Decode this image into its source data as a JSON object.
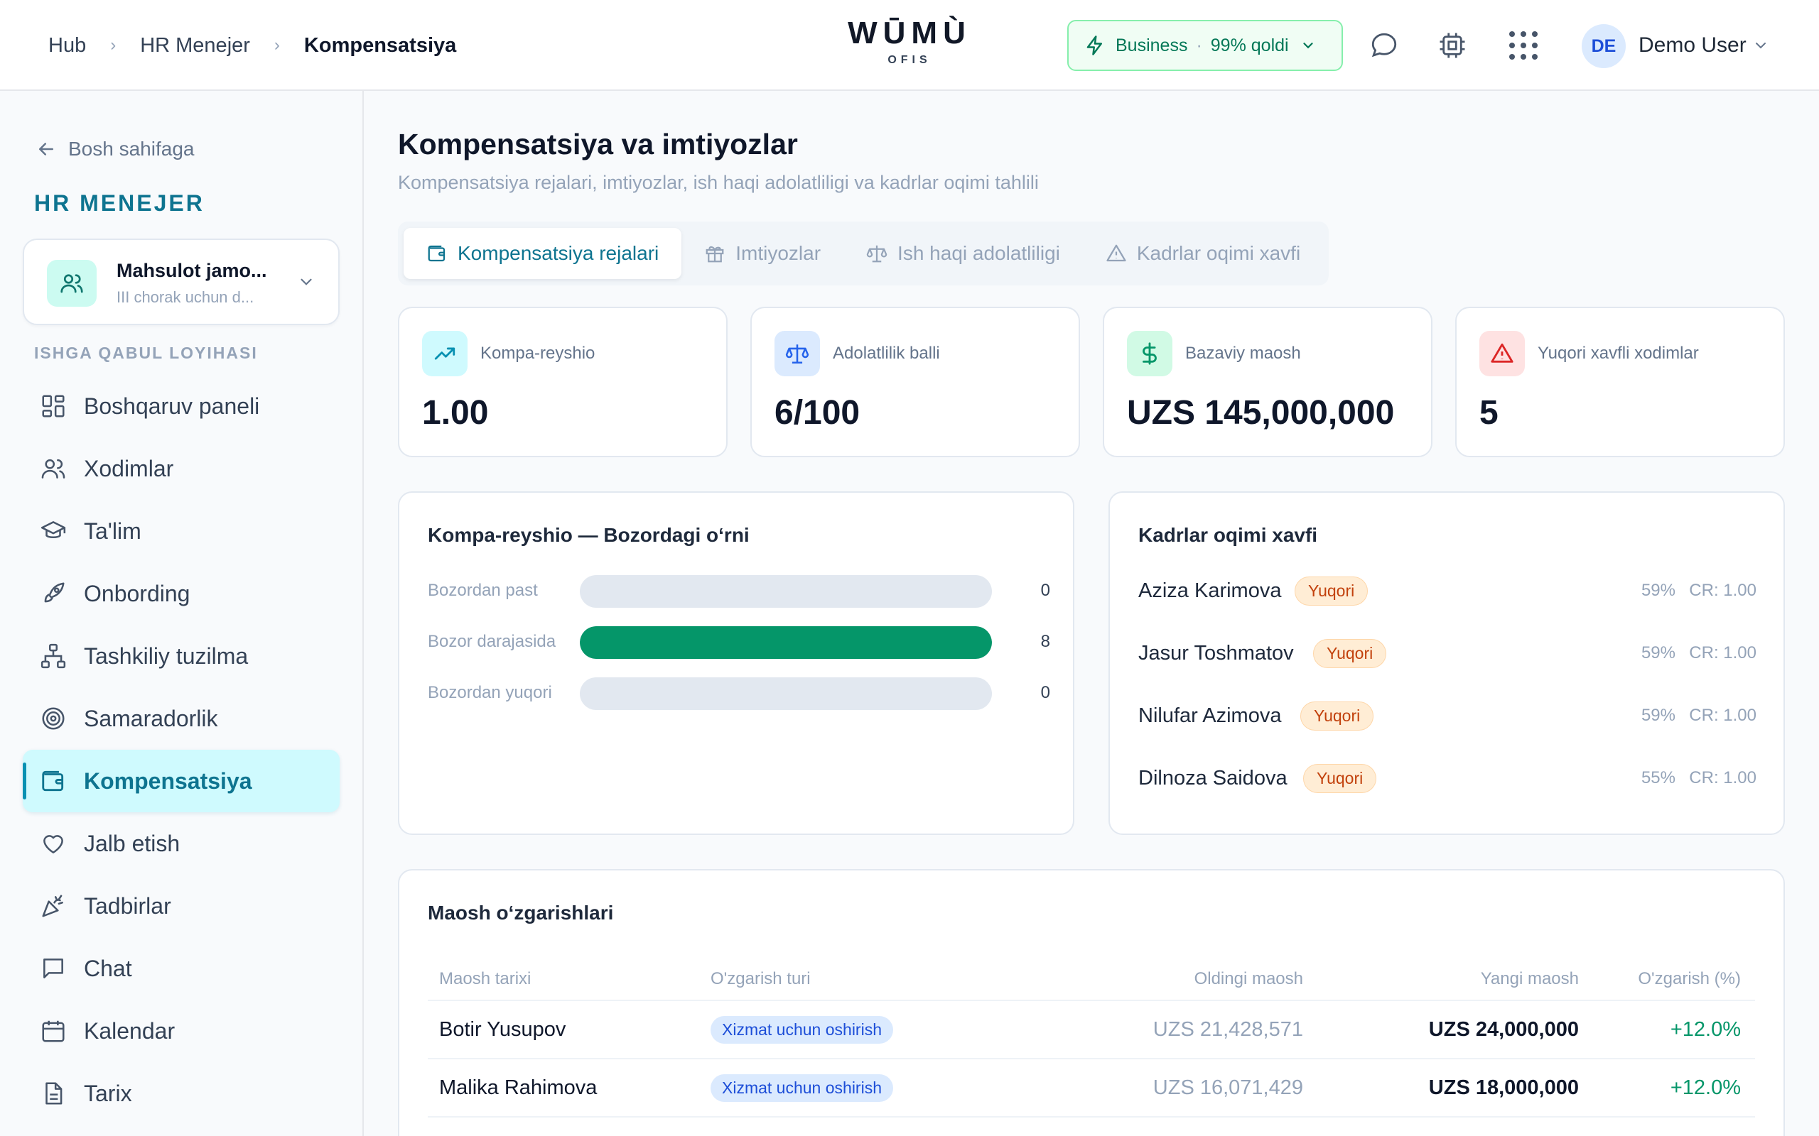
{
  "header": {
    "breadcrumbs": [
      "Hub",
      "HR Menejer",
      "Kompensatsiya"
    ],
    "logo_mark": "WŪMÙ",
    "logo_sub": "OFIS",
    "plan_name": "Business",
    "plan_dot": "·",
    "plan_quota": "99% qoldi",
    "user_initials": "DE",
    "user_name": "Demo User"
  },
  "sidebar": {
    "back_label": "Bosh sahifaga",
    "role_title": "HR MENEJER",
    "team_name": "Mahsulot jamo...",
    "team_sub": "III chorak uchun d...",
    "section_label": "ISHGA QABUL LOYIHASI",
    "items": [
      {
        "label": "Boshqaruv paneli",
        "icon": "dashboard-icon"
      },
      {
        "label": "Xodimlar",
        "icon": "users-icon"
      },
      {
        "label": "Ta'lim",
        "icon": "graduation-cap-icon"
      },
      {
        "label": "Onbording",
        "icon": "rocket-icon"
      },
      {
        "label": "Tashkiliy tuzilma",
        "icon": "org-chart-icon"
      },
      {
        "label": "Samaradorlik",
        "icon": "target-icon"
      },
      {
        "label": "Kompensatsiya",
        "icon": "wallet-icon",
        "active": true
      },
      {
        "label": "Jalb etish",
        "icon": "heart-icon"
      },
      {
        "label": "Tadbirlar",
        "icon": "party-icon"
      },
      {
        "label": "Chat",
        "icon": "chat-icon"
      },
      {
        "label": "Kalendar",
        "icon": "calendar-icon"
      },
      {
        "label": "Tarix",
        "icon": "document-icon"
      }
    ]
  },
  "page": {
    "title": "Kompensatsiya va imtiyozlar",
    "subtitle": "Kompensatsiya rejalari, imtiyozlar, ish haqi adolatliligi va kadrlar oqimi tahlili",
    "tabs": [
      {
        "label": "Kompensatsiya rejalari",
        "icon": "wallet-icon",
        "active": true
      },
      {
        "label": "Imtiyozlar",
        "icon": "gift-icon"
      },
      {
        "label": "Ish haqi adolatliligi",
        "icon": "scale-icon"
      },
      {
        "label": "Kadrlar oqimi xavfi",
        "icon": "warning-icon"
      }
    ]
  },
  "stats": [
    {
      "label": "Kompa-reyshio",
      "value": "1.00",
      "icon": "trending-up-icon",
      "color": "#0891b2"
    },
    {
      "label": "Adolatlilik balli",
      "value": "6/100",
      "icon": "scale-icon",
      "color": "#2563eb"
    },
    {
      "label": "Bazaviy maosh",
      "value": "UZS 145,000,000",
      "icon": "dollar-icon",
      "color": "#059669"
    },
    {
      "label": "Yuqori xavfli xodimlar",
      "value": "5",
      "icon": "warning-icon",
      "color": "#dc2626"
    }
  ],
  "market_position": {
    "title": "Kompa-reyshio — Bozordagi o‘rni",
    "rows": [
      {
        "label": "Bozordan past",
        "value": 0
      },
      {
        "label": "Bozor darajasida",
        "value": 8
      },
      {
        "label": "Bozordan yuqori",
        "value": 0
      }
    ]
  },
  "attrition": {
    "title": "Kadrlar oqimi xavfi",
    "rows": [
      {
        "name": "Aziza Karimova",
        "badge": "Yuqori",
        "pct": "59%",
        "cr": "CR: 1.00"
      },
      {
        "name": "Jasur Toshmatov",
        "badge": "Yuqori",
        "pct": "59%",
        "cr": "CR: 1.00"
      },
      {
        "name": "Nilufar Azimova",
        "badge": "Yuqori",
        "pct": "59%",
        "cr": "CR: 1.00"
      },
      {
        "name": "Dilnoza Saidova",
        "badge": "Yuqori",
        "pct": "55%",
        "cr": "CR: 1.00"
      }
    ]
  },
  "salary_changes": {
    "title": "Maosh o‘zgarishlari",
    "columns": [
      "Maosh tarixi",
      "O'zgarish turi",
      "Oldingi maosh",
      "Yangi maosh",
      "O'zgarish (%)"
    ],
    "rows": [
      {
        "name": "Botir Yusupov",
        "type": "Xizmat uchun oshirish",
        "old": "UZS 21,428,571",
        "new": "UZS 24,000,000",
        "change": "+12.0%"
      },
      {
        "name": "Malika Rahimova",
        "type": "Xizmat uchun oshirish",
        "old": "UZS 16,071,429",
        "new": "UZS 18,000,000",
        "change": "+12.0%"
      }
    ]
  }
}
